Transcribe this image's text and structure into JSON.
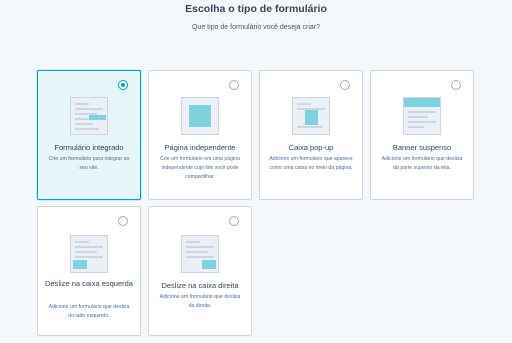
{
  "header": {
    "title": "Escolha o tipo de formulário",
    "subtitle": "Que tipo de formulário você deseja criar?"
  },
  "form_types": [
    {
      "title": "Formulário integrado",
      "description": "Crie um formulário para integrar ao seu site.",
      "selected": true,
      "icon": "embedded-form-icon"
    },
    {
      "title": "Página independente",
      "description": "Crie um formulário em uma página independente cujo link você pode compartilhar.",
      "selected": false,
      "icon": "standalone-page-icon"
    },
    {
      "title": "Caixa pop-up",
      "description": "Adicione um formulário que aparece como uma caixa no meio da página.",
      "selected": false,
      "icon": "popup-box-icon"
    },
    {
      "title": "Banner suspenso",
      "description": "Adicione um formulário que desliza da parte superior da tela.",
      "selected": false,
      "icon": "dropdown-banner-icon"
    },
    {
      "title": "Deslize na caixa esquerda",
      "description": "Adicione um formulário que desliza do lado esquerdo.",
      "selected": false,
      "icon": "slide-in-left-icon"
    },
    {
      "title": "Deslize na caixa direita",
      "description": "Adicione um formulário que desliza da direita.",
      "selected": false,
      "icon": "slide-in-right-icon"
    }
  ],
  "colors": {
    "accent": "#00a4bd",
    "selected_bg": "#e5f5f8",
    "thumb_block": "#7fd1de"
  }
}
